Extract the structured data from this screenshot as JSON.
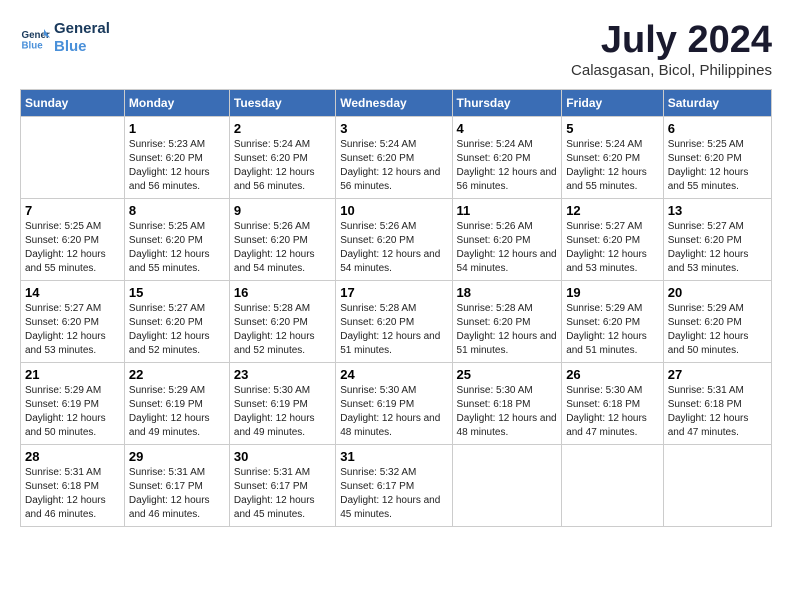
{
  "logo": {
    "line1": "General",
    "line2": "Blue"
  },
  "title": "July 2024",
  "location": "Calasgasan, Bicol, Philippines",
  "days_header": [
    "Sunday",
    "Monday",
    "Tuesday",
    "Wednesday",
    "Thursday",
    "Friday",
    "Saturday"
  ],
  "weeks": [
    [
      {
        "num": "",
        "empty": true
      },
      {
        "num": "1",
        "sunrise": "5:23 AM",
        "sunset": "6:20 PM",
        "daylight": "12 hours and 56 minutes."
      },
      {
        "num": "2",
        "sunrise": "5:24 AM",
        "sunset": "6:20 PM",
        "daylight": "12 hours and 56 minutes."
      },
      {
        "num": "3",
        "sunrise": "5:24 AM",
        "sunset": "6:20 PM",
        "daylight": "12 hours and 56 minutes."
      },
      {
        "num": "4",
        "sunrise": "5:24 AM",
        "sunset": "6:20 PM",
        "daylight": "12 hours and 56 minutes."
      },
      {
        "num": "5",
        "sunrise": "5:24 AM",
        "sunset": "6:20 PM",
        "daylight": "12 hours and 55 minutes."
      },
      {
        "num": "6",
        "sunrise": "5:25 AM",
        "sunset": "6:20 PM",
        "daylight": "12 hours and 55 minutes."
      }
    ],
    [
      {
        "num": "7",
        "sunrise": "5:25 AM",
        "sunset": "6:20 PM",
        "daylight": "12 hours and 55 minutes."
      },
      {
        "num": "8",
        "sunrise": "5:25 AM",
        "sunset": "6:20 PM",
        "daylight": "12 hours and 55 minutes."
      },
      {
        "num": "9",
        "sunrise": "5:26 AM",
        "sunset": "6:20 PM",
        "daylight": "12 hours and 54 minutes."
      },
      {
        "num": "10",
        "sunrise": "5:26 AM",
        "sunset": "6:20 PM",
        "daylight": "12 hours and 54 minutes."
      },
      {
        "num": "11",
        "sunrise": "5:26 AM",
        "sunset": "6:20 PM",
        "daylight": "12 hours and 54 minutes."
      },
      {
        "num": "12",
        "sunrise": "5:27 AM",
        "sunset": "6:20 PM",
        "daylight": "12 hours and 53 minutes."
      },
      {
        "num": "13",
        "sunrise": "5:27 AM",
        "sunset": "6:20 PM",
        "daylight": "12 hours and 53 minutes."
      }
    ],
    [
      {
        "num": "14",
        "sunrise": "5:27 AM",
        "sunset": "6:20 PM",
        "daylight": "12 hours and 53 minutes."
      },
      {
        "num": "15",
        "sunrise": "5:27 AM",
        "sunset": "6:20 PM",
        "daylight": "12 hours and 52 minutes."
      },
      {
        "num": "16",
        "sunrise": "5:28 AM",
        "sunset": "6:20 PM",
        "daylight": "12 hours and 52 minutes."
      },
      {
        "num": "17",
        "sunrise": "5:28 AM",
        "sunset": "6:20 PM",
        "daylight": "12 hours and 51 minutes."
      },
      {
        "num": "18",
        "sunrise": "5:28 AM",
        "sunset": "6:20 PM",
        "daylight": "12 hours and 51 minutes."
      },
      {
        "num": "19",
        "sunrise": "5:29 AM",
        "sunset": "6:20 PM",
        "daylight": "12 hours and 51 minutes."
      },
      {
        "num": "20",
        "sunrise": "5:29 AM",
        "sunset": "6:20 PM",
        "daylight": "12 hours and 50 minutes."
      }
    ],
    [
      {
        "num": "21",
        "sunrise": "5:29 AM",
        "sunset": "6:19 PM",
        "daylight": "12 hours and 50 minutes."
      },
      {
        "num": "22",
        "sunrise": "5:29 AM",
        "sunset": "6:19 PM",
        "daylight": "12 hours and 49 minutes."
      },
      {
        "num": "23",
        "sunrise": "5:30 AM",
        "sunset": "6:19 PM",
        "daylight": "12 hours and 49 minutes."
      },
      {
        "num": "24",
        "sunrise": "5:30 AM",
        "sunset": "6:19 PM",
        "daylight": "12 hours and 48 minutes."
      },
      {
        "num": "25",
        "sunrise": "5:30 AM",
        "sunset": "6:18 PM",
        "daylight": "12 hours and 48 minutes."
      },
      {
        "num": "26",
        "sunrise": "5:30 AM",
        "sunset": "6:18 PM",
        "daylight": "12 hours and 47 minutes."
      },
      {
        "num": "27",
        "sunrise": "5:31 AM",
        "sunset": "6:18 PM",
        "daylight": "12 hours and 47 minutes."
      }
    ],
    [
      {
        "num": "28",
        "sunrise": "5:31 AM",
        "sunset": "6:18 PM",
        "daylight": "12 hours and 46 minutes."
      },
      {
        "num": "29",
        "sunrise": "5:31 AM",
        "sunset": "6:17 PM",
        "daylight": "12 hours and 46 minutes."
      },
      {
        "num": "30",
        "sunrise": "5:31 AM",
        "sunset": "6:17 PM",
        "daylight": "12 hours and 45 minutes."
      },
      {
        "num": "31",
        "sunrise": "5:32 AM",
        "sunset": "6:17 PM",
        "daylight": "12 hours and 45 minutes."
      },
      {
        "num": "",
        "empty": true
      },
      {
        "num": "",
        "empty": true
      },
      {
        "num": "",
        "empty": true
      }
    ]
  ]
}
